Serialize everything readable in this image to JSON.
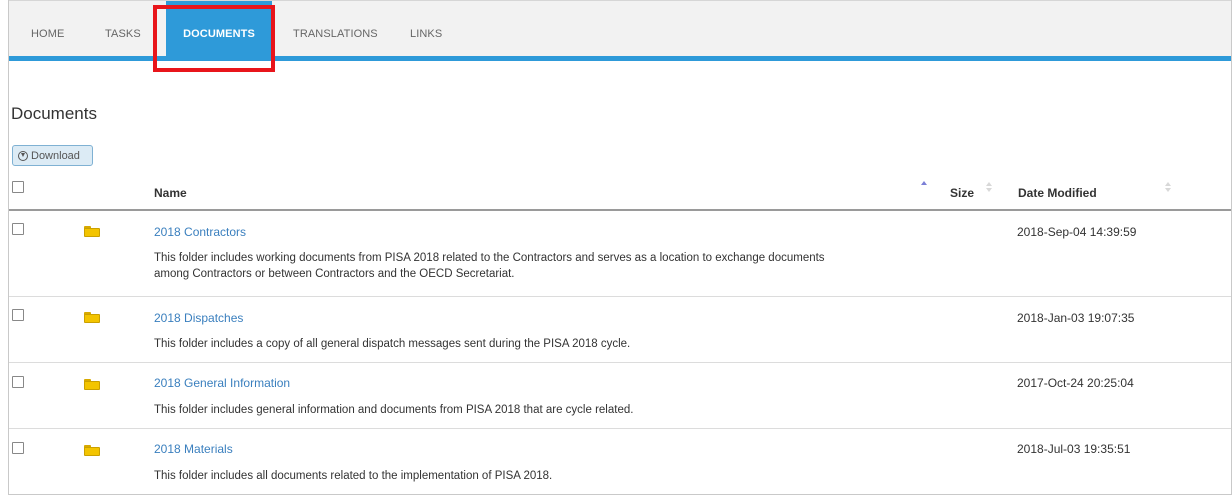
{
  "nav": {
    "items": [
      {
        "label": "HOME"
      },
      {
        "label": "TASKS"
      },
      {
        "label": "DOCUMENTS",
        "active": true
      },
      {
        "label": "TRANSLATIONS"
      },
      {
        "label": "LINKS"
      }
    ]
  },
  "section_title": "Documents",
  "download_label": "Download",
  "table": {
    "columns": {
      "name": "Name",
      "size": "Size",
      "date": "Date Modified"
    },
    "rows": [
      {
        "name": "2018 Contractors",
        "description": "This folder includes working documents from PISA 2018 related to the Contractors and serves as a location to exchange documents among Contractors or between Contractors and the OECD Secretariat.",
        "date": "2018-Sep-04 14:39:59"
      },
      {
        "name": "2018 Dispatches",
        "description": "This folder includes a copy of all general dispatch messages sent during the PISA 2018 cycle.",
        "date": "2018-Jan-03 19:07:35"
      },
      {
        "name": "2018 General Information",
        "description": "This folder includes general information and documents from PISA 2018 that are cycle related.",
        "date": "2017-Oct-24 20:25:04"
      },
      {
        "name": "2018 Materials",
        "description": "This folder includes all documents related to the implementation of PISA 2018.",
        "date": "2018-Jul-03 19:35:51"
      }
    ]
  },
  "colors": {
    "accent": "#2e9ad9",
    "highlight": "#e8151b",
    "link": "#3a7fbe",
    "folder": "#f3c400"
  }
}
